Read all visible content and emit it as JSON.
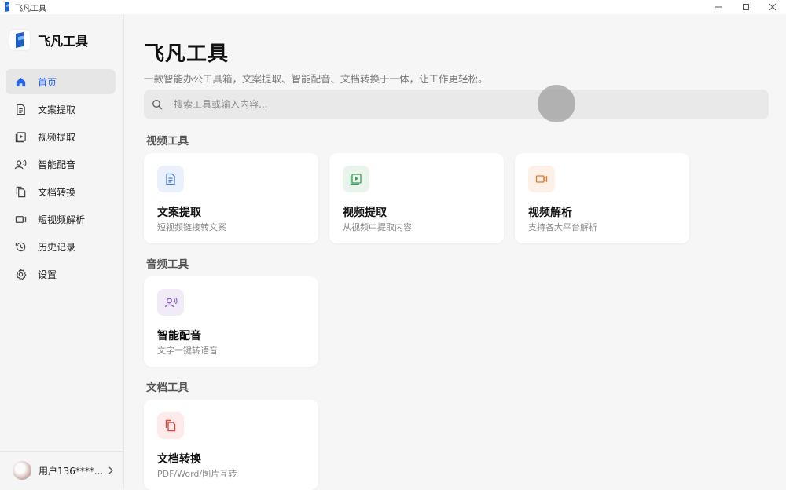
{
  "window": {
    "title": "飞凡工具"
  },
  "sidebar": {
    "brand": "飞凡工具",
    "items": [
      {
        "label": "首页",
        "icon": "home-icon",
        "active": true
      },
      {
        "label": "文案提取",
        "icon": "document-icon"
      },
      {
        "label": "视频提取",
        "icon": "video-play-icon"
      },
      {
        "label": "智能配音",
        "icon": "voice-person-icon"
      },
      {
        "label": "文档转换",
        "icon": "copy-icon"
      },
      {
        "label": "短视频解析",
        "icon": "camera-icon"
      },
      {
        "label": "历史记录",
        "icon": "history-icon"
      },
      {
        "label": "设置",
        "icon": "gear-icon"
      }
    ],
    "user": {
      "name": "用户136****..."
    }
  },
  "main": {
    "title": "飞凡工具",
    "subtitle": "一款智能办公工具箱，文案提取、智能配音、文档转换于一体，让工作更轻松。",
    "search": {
      "placeholder": "搜索工具或输入内容..."
    },
    "sections": [
      {
        "title": "视频工具",
        "cards": [
          {
            "title": "文案提取",
            "desc": "短视频链接转文案",
            "icon": "document-icon",
            "color": "#4a7fd4",
            "bg": "#eaf1fb"
          },
          {
            "title": "视频提取",
            "desc": "从视频中提取内容",
            "icon": "video-play-icon",
            "color": "#3f9a5c",
            "bg": "#e9f5ec"
          },
          {
            "title": "视频解析",
            "desc": "支持各大平台解析",
            "icon": "camera-icon",
            "color": "#e07a2e",
            "bg": "#fdf0e6"
          }
        ]
      },
      {
        "title": "音频工具",
        "cards": [
          {
            "title": "智能配音",
            "desc": "文字一键转语音",
            "icon": "voice-person-icon",
            "color": "#8d5fc4",
            "bg": "#f1ebf8"
          }
        ]
      },
      {
        "title": "文档工具",
        "cards": [
          {
            "title": "文档转换",
            "desc": "PDF/Word/图片互转",
            "icon": "copy-icon",
            "color": "#d9463b",
            "bg": "#fcebea"
          }
        ]
      }
    ]
  }
}
